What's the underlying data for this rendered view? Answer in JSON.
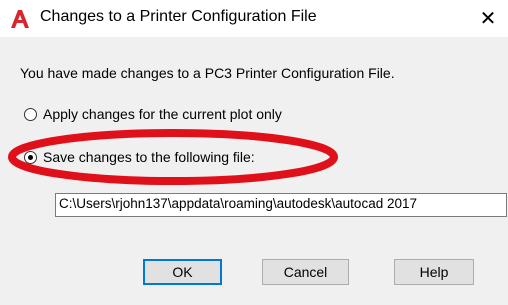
{
  "window": {
    "title": "Changes to a Printer Configuration File",
    "close_glyph": "✕",
    "icon": "autocad-logo-icon",
    "icon_color": "#d9252d"
  },
  "message": "You have made changes to a PC3 Printer Configuration File.",
  "options": [
    {
      "label": "Apply changes for the current plot only",
      "checked": false
    },
    {
      "label": "Save changes to the following file:",
      "checked": true
    }
  ],
  "file_path": {
    "value": "C:\\Users\\rjohn137\\appdata\\roaming\\autodesk\\autocad 2017"
  },
  "buttons": {
    "ok": "OK",
    "cancel": "Cancel",
    "help": "Help"
  },
  "annotation": {
    "shape": "red-ellipse-highlight",
    "color": "#e0101a"
  }
}
